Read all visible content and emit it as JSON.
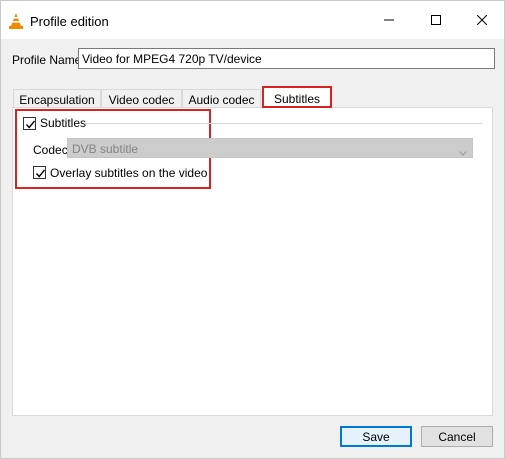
{
  "window": {
    "title": "Profile edition",
    "icon": "vlc-cone-icon"
  },
  "profile": {
    "label": "Profile Name",
    "value": "Video for MPEG4 720p TV/device"
  },
  "tabs": [
    {
      "label": "Encapsulation",
      "selected": false
    },
    {
      "label": "Video codec",
      "selected": false
    },
    {
      "label": "Audio codec",
      "selected": false
    },
    {
      "label": "Subtitles",
      "selected": true
    }
  ],
  "subtitles": {
    "enable_label": "Subtitles",
    "enable_checked": true,
    "codec_label": "Codec",
    "codec_value": "DVB subtitle",
    "overlay_label": "Overlay subtitles on the video",
    "overlay_checked": true
  },
  "buttons": {
    "save": "Save",
    "cancel": "Cancel"
  },
  "colors": {
    "highlight": "#d92323",
    "focus": "#0078d7"
  }
}
